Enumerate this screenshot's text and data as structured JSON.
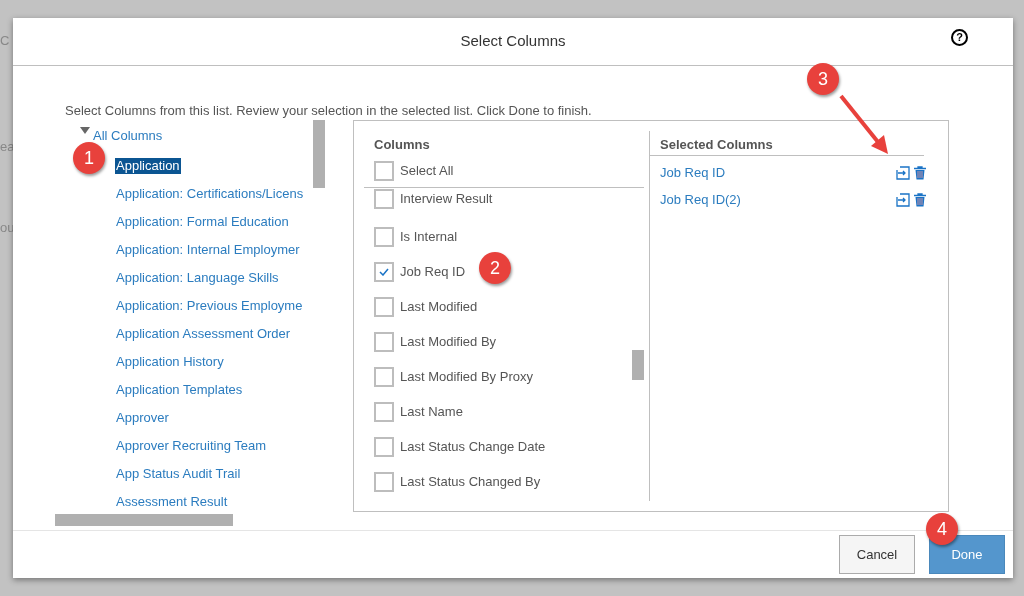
{
  "background_fragments": [
    "C",
    "ea",
    "ou"
  ],
  "dialog": {
    "title": "Select Columns",
    "help_icon": "?"
  },
  "instruction": "Select Columns from this list. Review your selection in the selected list. Click Done to finish.",
  "tree": {
    "label": "All Columns",
    "expanded": true,
    "children": [
      {
        "label": "Application",
        "selected": true
      },
      {
        "label": "Application: Certifications/Licens",
        "selected": false
      },
      {
        "label": "Application: Formal Education",
        "selected": false
      },
      {
        "label": "Application: Internal Employmer",
        "selected": false
      },
      {
        "label": "Application: Language Skills",
        "selected": false
      },
      {
        "label": "Application: Previous Employme",
        "selected": false
      },
      {
        "label": "Application Assessment Order",
        "selected": false
      },
      {
        "label": "Application History",
        "selected": false
      },
      {
        "label": "Application Templates",
        "selected": false
      },
      {
        "label": "Approver",
        "selected": false
      },
      {
        "label": "Approver Recruiting Team",
        "selected": false
      },
      {
        "label": "App Status Audit Trail",
        "selected": false
      },
      {
        "label": "Assessment Result",
        "selected": false
      }
    ]
  },
  "columns": {
    "heading": "Columns",
    "select_all": {
      "label": "Select All",
      "checked": false
    },
    "items": [
      {
        "label": "Interview Result",
        "checked": false
      },
      {
        "label": "Is Internal",
        "checked": false
      },
      {
        "label": "Job Req ID",
        "checked": true
      },
      {
        "label": "Last Modified",
        "checked": false
      },
      {
        "label": "Last Modified By",
        "checked": false
      },
      {
        "label": "Last Modified By Proxy",
        "checked": false
      },
      {
        "label": "Last Name",
        "checked": false
      },
      {
        "label": "Last Status Change Date",
        "checked": false
      },
      {
        "label": "Last Status Changed By",
        "checked": false
      }
    ]
  },
  "selected_columns": {
    "heading": "Selected Columns",
    "items": [
      {
        "label": "Job Req ID"
      },
      {
        "label": "Job Req ID(2)"
      }
    ]
  },
  "buttons": [
    {
      "label": "Cancel",
      "kind": "secondary"
    },
    {
      "label": "Done",
      "kind": "primary"
    }
  ],
  "callouts": [
    "1",
    "2",
    "3",
    "4"
  ]
}
